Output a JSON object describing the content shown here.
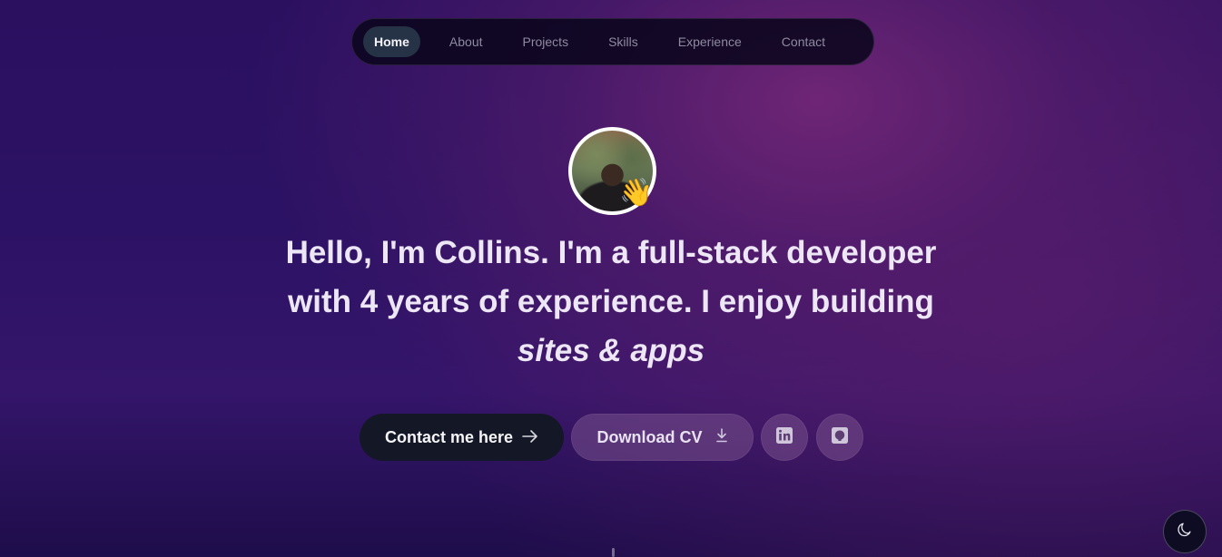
{
  "nav": {
    "items": [
      {
        "label": "Home",
        "active": true
      },
      {
        "label": "About",
        "active": false
      },
      {
        "label": "Projects",
        "active": false
      },
      {
        "label": "Skills",
        "active": false
      },
      {
        "label": "Experience",
        "active": false
      },
      {
        "label": "Contact",
        "active": false
      }
    ]
  },
  "hero": {
    "avatar_icon": "profile-photo",
    "wave_emoji": "👋",
    "intro_bold": "Hello, I'm Collins.",
    "intro_text": " I'm a ",
    "role_bold": "full-stack developer",
    "with_text": "with ",
    "years_bold": "4 years",
    "experience_text": " of experience. I enjoy building",
    "sites_italic": "sites & apps"
  },
  "actions": {
    "contact_label": "Contact me here",
    "contact_icon": "arrow-right-icon",
    "cv_label": "Download CV",
    "cv_icon": "download-icon",
    "linkedin_icon": "linkedin-icon",
    "github_icon": "github-icon"
  },
  "theme": {
    "toggle_icon": "moon-icon"
  },
  "colors": {
    "background_primary": "#2c1264",
    "background_glow": "#782878",
    "nav_background": "#0a061c",
    "nav_active": "#263246",
    "contact_button": "#141725",
    "secondary_button": "#784f8c"
  }
}
